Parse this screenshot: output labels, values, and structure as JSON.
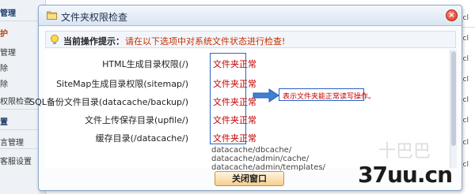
{
  "sidebar": {
    "items": [
      "管理",
      "护",
      "管理",
      "除",
      "除",
      "权限检查",
      "置",
      "言管理",
      "客服设置"
    ]
  },
  "right_background": {
    "items": [
      "_cl",
      "_cl",
      "_cl",
      "_cl",
      "_cl",
      "_cl",
      "_cl",
      "_cl"
    ]
  },
  "dialog": {
    "title": "文件夹权限检查",
    "close_glyph": "×",
    "tip_label": "当前操作提示：",
    "tip_text": "请在以下选项中对系统文件状态进行检查!",
    "rows": [
      {
        "label": "HTML生成目录权限(/)",
        "status": "文件夹正常"
      },
      {
        "label": "SiteMap生成目录权限(sitemap/)",
        "status": "文件夹正常"
      },
      {
        "label": "SQL备份文件目录(datacache/backup/)",
        "status": "文件夹正常"
      },
      {
        "label": "文件上传保存目录(upfile/)",
        "status": "文件夹正常"
      },
      {
        "label": "缓存目录(/datacache/)",
        "status": "文件夹正常"
      }
    ],
    "extra_paths": [
      "datacache/dbcache/",
      "datacache/admin/cache/",
      "datacache/admin/templates/"
    ],
    "callout": "表示文件夹能正常读写操作。",
    "close_button": "关闭窗口"
  },
  "watermark": {
    "faint": "十巴巴",
    "brand": "37uu.cn"
  },
  "colors": {
    "status_red": "#c40000",
    "tip_orange": "#c53000",
    "highlight_blue": "#2d63c4",
    "arrow_blue": "#3f7fd6"
  }
}
